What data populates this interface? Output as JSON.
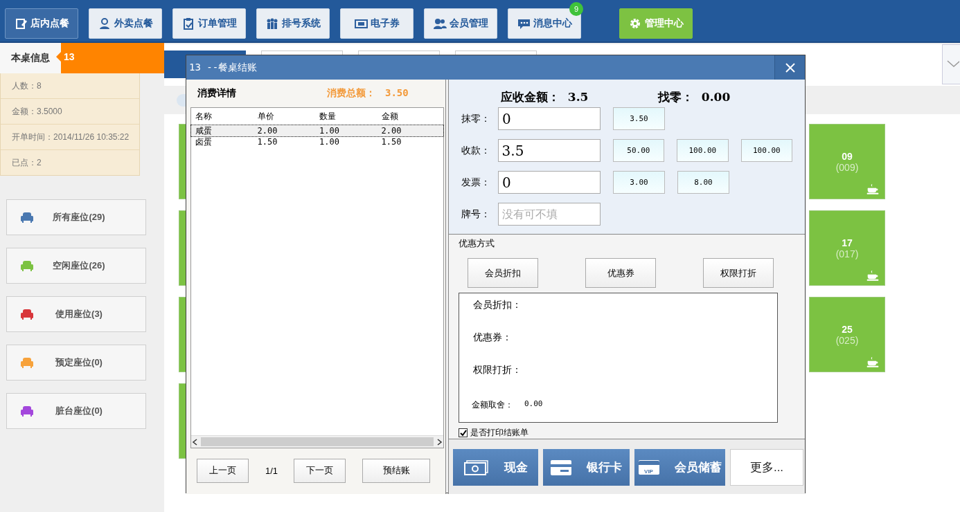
{
  "nav": {
    "items": [
      {
        "label": "店内点餐",
        "selected": true,
        "kind": "normal"
      },
      {
        "label": "外卖点餐",
        "selected": false,
        "kind": "normal"
      },
      {
        "label": "订单管理",
        "selected": false,
        "kind": "normal"
      },
      {
        "label": "排号系统",
        "selected": false,
        "kind": "normal"
      },
      {
        "label": "电子券",
        "selected": false,
        "kind": "normal"
      },
      {
        "label": "会员管理",
        "selected": false,
        "kind": "normal"
      },
      {
        "label": "消息中心",
        "selected": false,
        "kind": "normal",
        "badge": "9"
      },
      {
        "label": "管理中心",
        "selected": false,
        "kind": "admin"
      }
    ]
  },
  "table_info": {
    "title": "本桌信息",
    "table_no": "13",
    "rows": [
      "人数：8",
      "金额：3.5000",
      "开单时间：2014/11/26 10:35:22",
      "已点：2"
    ]
  },
  "seat_filters": [
    {
      "label": "所有座位(29)",
      "color": "#4a78b0"
    },
    {
      "label": "空闲座位(26)",
      "color": "#7cc242"
    },
    {
      "label": "使用座位(3)",
      "color": "#d8363a"
    },
    {
      "label": "预定座位(0)",
      "color": "#f7a23b"
    },
    {
      "label": "脏台座位(0)",
      "color": "#a347dc"
    }
  ],
  "tabs": [
    {
      "selected": true
    },
    {
      "selected": false
    },
    {
      "selected": false
    },
    {
      "selected": false
    }
  ],
  "tiles": [
    {
      "name": "09",
      "code": "(009)"
    },
    {
      "name": "17",
      "code": "(017)"
    },
    {
      "name": "25",
      "code": "(025)"
    }
  ],
  "dialog": {
    "title": "13 --餐桌结账",
    "details": {
      "heading": "消费详情",
      "total_label": "消费总额：",
      "total": "3.50",
      "columns": [
        "名称",
        "单价",
        "数量",
        "金额"
      ],
      "rows": [
        {
          "cells": [
            "咸蛋",
            "2.00",
            "1.00",
            "2.00"
          ],
          "selected": true
        },
        {
          "cells": [
            "卤蛋",
            "1.50",
            "1.00",
            "1.50"
          ],
          "selected": false
        }
      ],
      "prev": "上一页",
      "page": "1/1",
      "next": "下一页",
      "prebill": "预结账"
    },
    "payment": {
      "due_label": "应收金额：",
      "due": "3.5",
      "change_label": "找零：",
      "change": "0.00",
      "fields": [
        {
          "label": "抹零：",
          "value": "0",
          "quick": [
            "3.50"
          ]
        },
        {
          "label": "收款：",
          "value": "3.5",
          "quick": [
            "50.00",
            "100.00",
            "100.00"
          ]
        },
        {
          "label": "发票：",
          "value": "0",
          "quick": [
            "3.00",
            "8.00"
          ]
        },
        {
          "label": "牌号：",
          "placeholder": "没有可不填"
        }
      ]
    },
    "discount": {
      "title": "优惠方式",
      "buttons": [
        "会员折扣",
        "优惠券",
        "权限打折"
      ],
      "lines": [
        "会员折扣：",
        "优惠券：",
        "权限打折："
      ],
      "rounding_label": "金额取舍：",
      "rounding": "0.00",
      "print_receipt": {
        "label": "是否打印结账单",
        "checked": true
      }
    },
    "methods": [
      {
        "label": "现金",
        "kind": "cash"
      },
      {
        "label": "银行卡",
        "kind": "card"
      },
      {
        "label": "会员储蓄",
        "kind": "vip",
        "icon_text": "VIP"
      },
      {
        "label": "更多...",
        "kind": "more"
      }
    ]
  }
}
